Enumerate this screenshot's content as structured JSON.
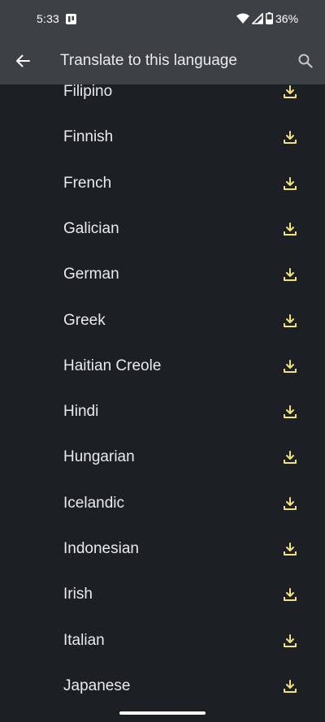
{
  "status_bar": {
    "time": "5:33",
    "battery": "36%",
    "icons": [
      "notification-icon",
      "wifi-icon",
      "signal-icon",
      "battery-icon"
    ]
  },
  "toolbar": {
    "title": "Translate to this language",
    "back_icon": "arrow-back-icon",
    "search_icon": "search-icon"
  },
  "languages": [
    {
      "label": "Filipino",
      "action_icon": "download-icon"
    },
    {
      "label": "Finnish",
      "action_icon": "download-icon"
    },
    {
      "label": "French",
      "action_icon": "download-icon"
    },
    {
      "label": "Galician",
      "action_icon": "download-icon"
    },
    {
      "label": "German",
      "action_icon": "download-icon"
    },
    {
      "label": "Greek",
      "action_icon": "download-icon"
    },
    {
      "label": "Haitian Creole",
      "action_icon": "download-icon"
    },
    {
      "label": "Hindi",
      "action_icon": "download-icon"
    },
    {
      "label": "Hungarian",
      "action_icon": "download-icon"
    },
    {
      "label": "Icelandic",
      "action_icon": "download-icon"
    },
    {
      "label": "Indonesian",
      "action_icon": "download-icon"
    },
    {
      "label": "Irish",
      "action_icon": "download-icon"
    },
    {
      "label": "Italian",
      "action_icon": "download-icon"
    },
    {
      "label": "Japanese",
      "action_icon": "download-icon"
    }
  ],
  "colors": {
    "background": "#1c2024",
    "header": "#3d4146",
    "text": "#e8eaed",
    "download_accent": "#f3e27c"
  }
}
